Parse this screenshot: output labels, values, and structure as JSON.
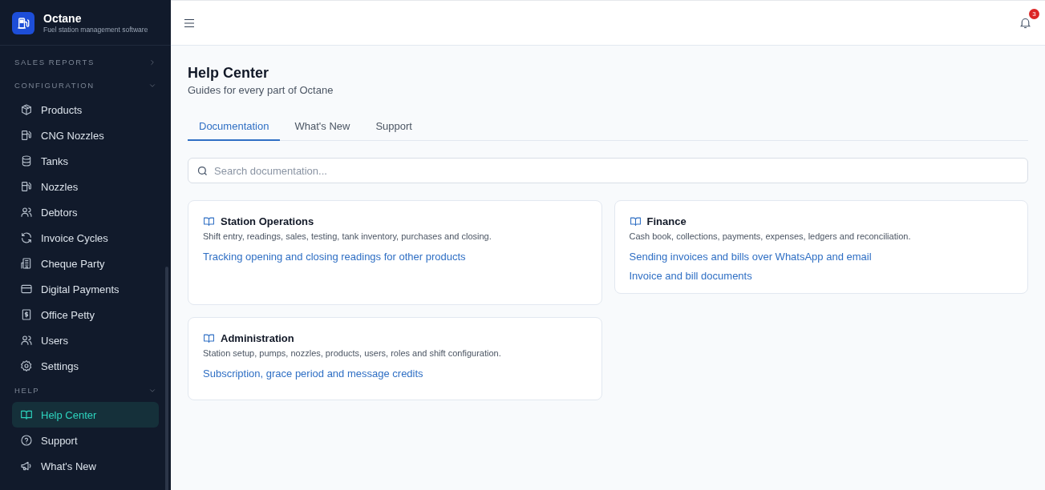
{
  "brand": {
    "name": "Octane",
    "tagline": "Fuel station management software"
  },
  "sidebar": {
    "sections": [
      {
        "title": "SALES REPORTS",
        "expanded": false
      },
      {
        "title": "CONFIGURATION",
        "expanded": true,
        "items": [
          {
            "label": "Products",
            "selected": false
          },
          {
            "label": "CNG Nozzles",
            "selected": false
          },
          {
            "label": "Tanks",
            "selected": false
          },
          {
            "label": "Nozzles",
            "selected": false
          },
          {
            "label": "Debtors",
            "selected": false
          },
          {
            "label": "Invoice Cycles",
            "selected": false
          },
          {
            "label": "Cheque Party",
            "selected": false
          },
          {
            "label": "Digital Payments",
            "selected": false
          },
          {
            "label": "Office Petty",
            "selected": false
          },
          {
            "label": "Users",
            "selected": false
          },
          {
            "label": "Settings",
            "selected": false
          }
        ]
      },
      {
        "title": "HELP",
        "expanded": true,
        "items": [
          {
            "label": "Help Center",
            "selected": true
          },
          {
            "label": "Support",
            "selected": false
          },
          {
            "label": "What's New",
            "selected": false
          }
        ]
      }
    ]
  },
  "topbar": {
    "notifications": "3"
  },
  "page": {
    "title": "Help Center",
    "subtitle": "Guides for every part of Octane"
  },
  "tabs": [
    {
      "label": "Documentation",
      "selected": true
    },
    {
      "label": "What's New",
      "selected": false
    },
    {
      "label": "Support",
      "selected": false
    }
  ],
  "search": {
    "placeholder": "Search documentation..."
  },
  "cards": [
    {
      "title": "Station Operations",
      "description": "Shift entry, readings, sales, testing, tank inventory, purchases and closing.",
      "links": [
        "Tracking opening and closing readings for other products"
      ]
    },
    {
      "title": "Finance",
      "description": "Cash book, collections, payments, expenses, ledgers and reconciliation.",
      "links": [
        "Sending invoices and bills over WhatsApp and email",
        "Invoice and bill documents"
      ]
    },
    {
      "title": "Administration",
      "description": "Station setup, pumps, nozzles, products, users, roles and shift configuration.",
      "links": [
        "Subscription, grace period and message credits"
      ]
    }
  ]
}
